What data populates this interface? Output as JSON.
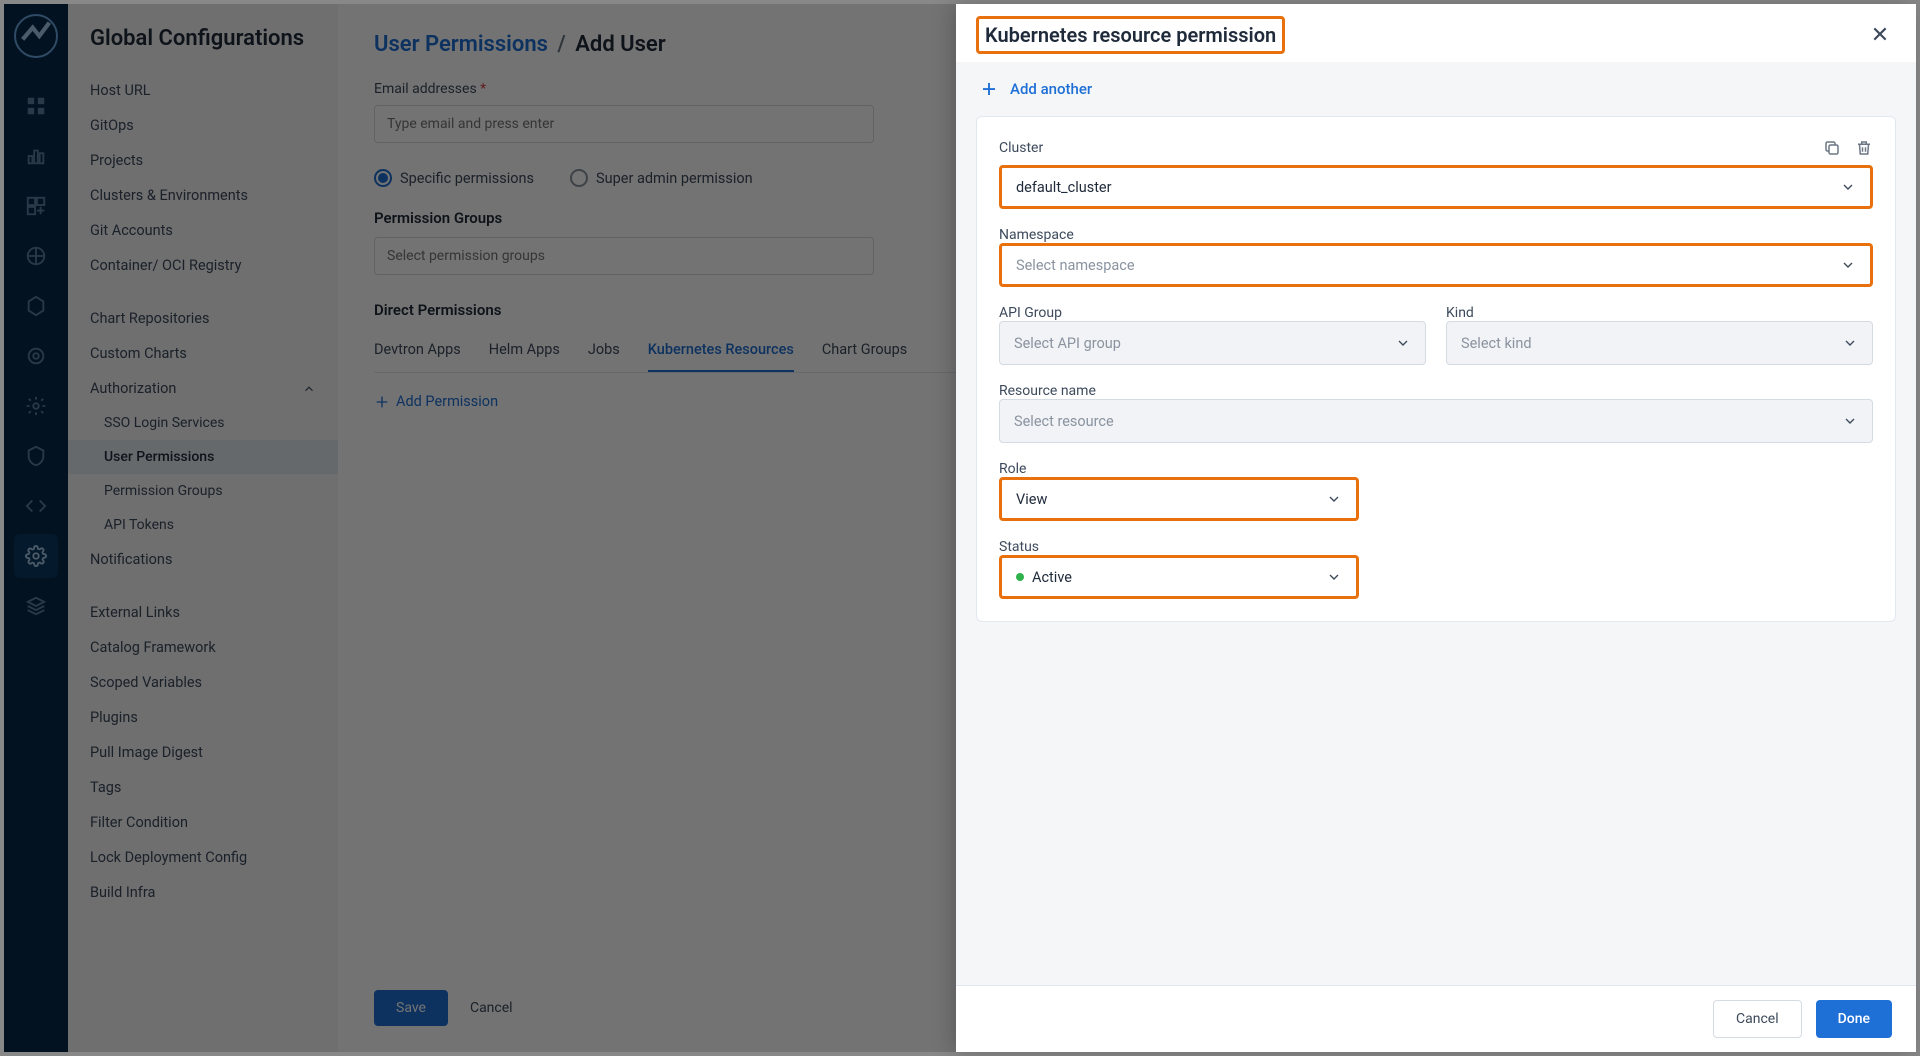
{
  "page_title": "Global Configurations",
  "sidebar": {
    "items": [
      {
        "label": "Host URL"
      },
      {
        "label": "GitOps"
      },
      {
        "label": "Projects"
      },
      {
        "label": "Clusters & Environments"
      },
      {
        "label": "Git Accounts"
      },
      {
        "label": "Container/ OCI Registry"
      }
    ],
    "items2": [
      {
        "label": "Chart Repositories"
      },
      {
        "label": "Custom Charts"
      }
    ],
    "auth": {
      "label": "Authorization"
    },
    "auth_children": [
      {
        "label": "SSO Login Services"
      },
      {
        "label": "User Permissions"
      },
      {
        "label": "Permission Groups"
      },
      {
        "label": "API Tokens"
      }
    ],
    "items3": [
      {
        "label": "Notifications"
      }
    ],
    "items4": [
      {
        "label": "External Links"
      },
      {
        "label": "Catalog Framework"
      },
      {
        "label": "Scoped Variables"
      },
      {
        "label": "Plugins"
      },
      {
        "label": "Pull Image Digest"
      },
      {
        "label": "Tags"
      },
      {
        "label": "Filter Condition"
      },
      {
        "label": "Lock Deployment Config"
      },
      {
        "label": "Build Infra"
      }
    ]
  },
  "main": {
    "breadcrumb_parent": "User Permissions",
    "breadcrumb_child": "Add User",
    "email_label": "Email addresses",
    "email_placeholder": "Type email and press enter",
    "radio_specific": "Specific permissions",
    "radio_super": "Super admin permission",
    "perm_groups_label": "Permission Groups",
    "perm_groups_placeholder": "Select permission groups",
    "direct_label": "Direct Permissions",
    "tabs": [
      "Devtron Apps",
      "Helm Apps",
      "Jobs",
      "Kubernetes Resources",
      "Chart Groups"
    ],
    "add_permission": "Add Permission",
    "save": "Save",
    "cancel": "Cancel"
  },
  "panel": {
    "title": "Kubernetes resource permission",
    "add_another": "Add another",
    "fields": {
      "cluster": {
        "label": "Cluster",
        "value": "default_cluster"
      },
      "namespace": {
        "label": "Namespace",
        "placeholder": "Select namespace"
      },
      "apigroup": {
        "label": "API Group",
        "placeholder": "Select API group"
      },
      "kind": {
        "label": "Kind",
        "placeholder": "Select kind"
      },
      "resource": {
        "label": "Resource name",
        "placeholder": "Select resource"
      },
      "role": {
        "label": "Role",
        "value": "View"
      },
      "status": {
        "label": "Status",
        "value": "Active"
      }
    },
    "cancel": "Cancel",
    "done": "Done"
  }
}
